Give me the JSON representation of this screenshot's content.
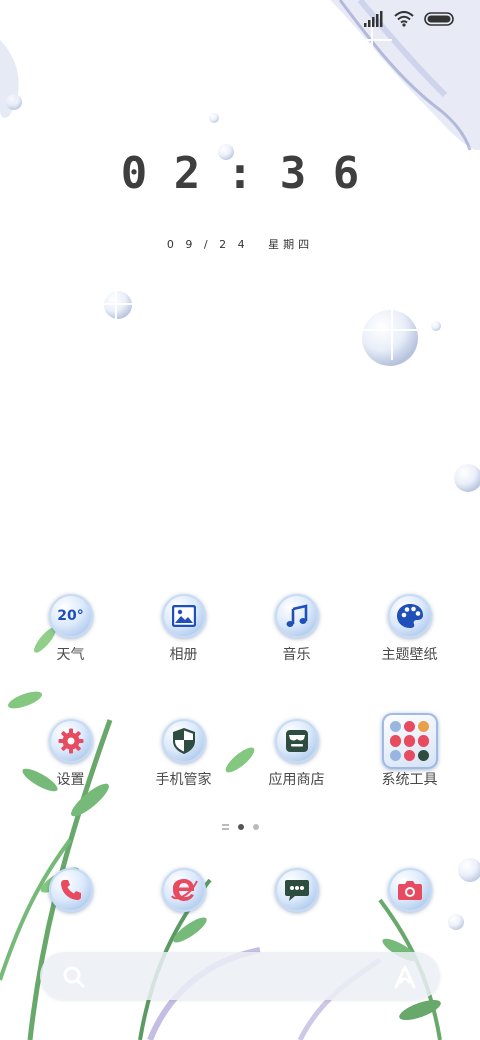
{
  "status_bar": {
    "signal_icon": "signal-icon",
    "wifi_icon": "wifi-icon",
    "battery_icon": "battery-icon"
  },
  "lockscreen": {
    "time": "0 2 : 3 6",
    "date": "0 9 / 2 4",
    "weekday": "星期四"
  },
  "apps_row1": [
    {
      "label": "天气",
      "icon": "weather-icon",
      "text": "20°"
    },
    {
      "label": "相册",
      "icon": "gallery-icon"
    },
    {
      "label": "音乐",
      "icon": "music-icon"
    },
    {
      "label": "主题壁纸",
      "icon": "theme-palette-icon"
    }
  ],
  "apps_row2": [
    {
      "label": "设置",
      "icon": "settings-gear-icon"
    },
    {
      "label": "手机管家",
      "icon": "security-shield-icon"
    },
    {
      "label": "应用商店",
      "icon": "app-store-icon"
    },
    {
      "label": "系统工具",
      "icon": "system-tools-folder-icon"
    }
  ],
  "page_indicator": {
    "count": 3,
    "active_index": 1
  },
  "dock": [
    {
      "name": "phone",
      "icon": "phone-icon"
    },
    {
      "name": "browser",
      "icon": "browser-icon"
    },
    {
      "name": "messages",
      "icon": "messages-icon"
    },
    {
      "name": "camera",
      "icon": "camera-icon"
    }
  ],
  "search_bar": {
    "search_icon": "search-icon",
    "assistant_icon": "assistant-icon"
  },
  "colors": {
    "icon_blue": "#1f4fb8",
    "icon_red": "#e84a5f",
    "leaf_green": "#4f9a52",
    "icon_dark": "#2e4d40"
  }
}
